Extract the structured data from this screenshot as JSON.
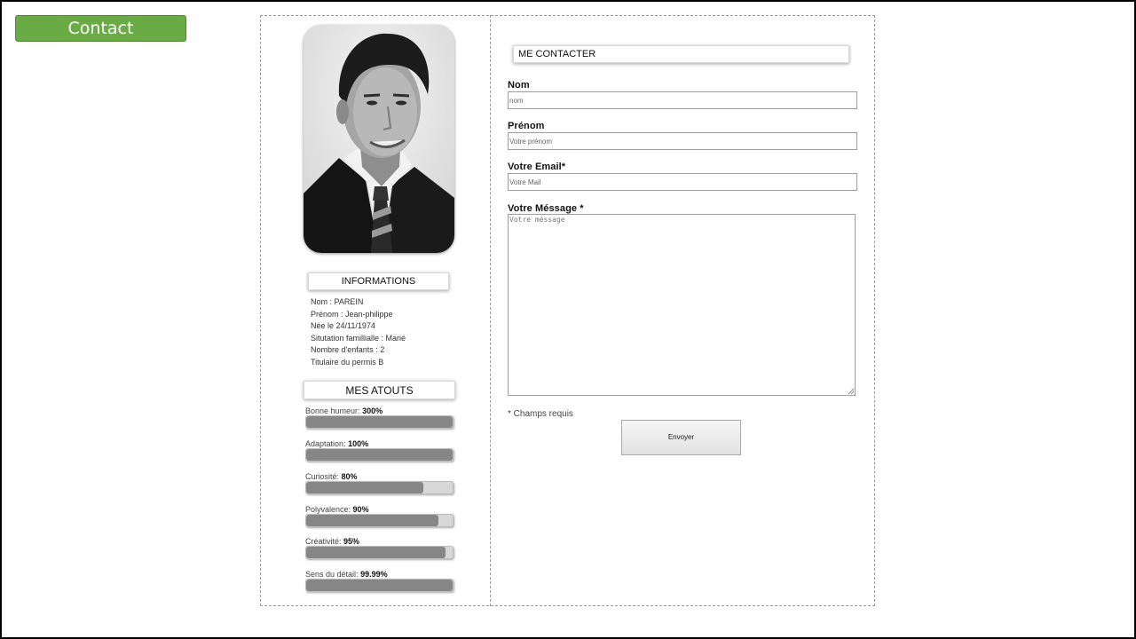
{
  "slide": {
    "badge_label": "Contact",
    "accent_color": "#6aab46"
  },
  "profile": {
    "photo_description_icon": "portrait-photo",
    "info_title": "INFORMATIONS",
    "info": [
      "Nom : PAREIN",
      "Prénom : Jean-philippe",
      "Née le 24/11/1974",
      "Situtation famillialle : Marié",
      "Nombre d'enfants : 2",
      "Titulaire du permis B"
    ],
    "atouts_title": "MES ATOUTS",
    "skills": [
      {
        "name": "Bonne humeur:",
        "value": "300%",
        "fill_fraction": 1.0
      },
      {
        "name": "Adaptation:",
        "value": "100%",
        "fill_fraction": 1.0
      },
      {
        "name": "Curiosité:",
        "value": "80%",
        "fill_fraction": 0.8
      },
      {
        "name": "Polyvalence:",
        "value": "90%",
        "fill_fraction": 0.9
      },
      {
        "name": "Créativité:",
        "value": "95%",
        "fill_fraction": 0.95
      },
      {
        "name": "Sens du détail:",
        "value": "99.99%",
        "fill_fraction": 0.9999
      }
    ]
  },
  "form": {
    "title": "ME CONTACTER",
    "nom_label": "Nom",
    "nom_placeholder": "nom",
    "prenom_label": "Prénom",
    "prenom_placeholder": "Votre prénom",
    "email_label": "Votre Email*",
    "email_placeholder": "Votre Mail",
    "message_label": "Votre Méssage *",
    "message_placeholder": "Votre méssage",
    "required_note": "* Champs requis",
    "submit_label": "Envoyer"
  }
}
